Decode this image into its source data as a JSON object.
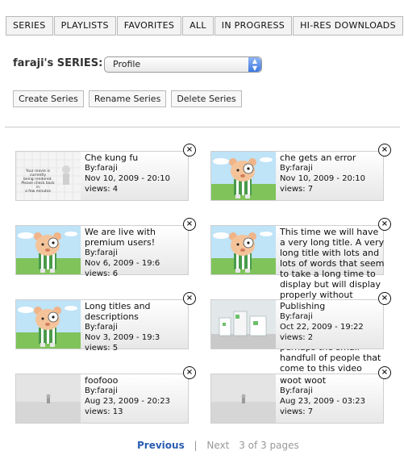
{
  "tabs": [
    "SERIES",
    "PLAYLISTS",
    "FAVORITES",
    "ALL",
    "IN PROGRESS",
    "HI-RES DOWNLOADS"
  ],
  "header": {
    "title": "faraji's SERIES:",
    "select_value": "Profile"
  },
  "buttons": {
    "create": "Create Series",
    "rename": "Rename Series",
    "delete": "Delete Series"
  },
  "cards": [
    {
      "title": "Che kung fu",
      "by": "By:faraji",
      "date": "Nov 10, 2009 - 20:10",
      "views": "views: 4",
      "thumb": "rendering",
      "thumb_lines": [
        "Your movie is currently",
        "being rendered.",
        "Please check back in",
        "a few minutes"
      ]
    },
    {
      "title": "che gets an error",
      "by": "By:faraji",
      "date": "Nov 10, 2009 - 20:10",
      "views": "views: 7",
      "thumb": "bear"
    },
    {
      "title": "We are live with premium users!",
      "by": "By:faraji",
      "date": "Nov 6, 2009 - 19:6",
      "views": "views: 6",
      "thumb": "bear"
    },
    {
      "title": "This time we will have a very long title. A very long title with lots and lots of words that seem to take a long time to display but will display properly without truncation and without generating errors or overflowing into other areas myself and perhaps the small handfull of people that come to this video expecting to be",
      "by": "By:faraji",
      "date": "Oct 22, 2009 - 19:22",
      "views": "views: 2",
      "thumb": "bear"
    },
    {
      "title": "Long titles and descriptions",
      "by": "By:faraji",
      "date": "Nov 3, 2009 - 19:3",
      "views": "views: 5",
      "thumb": "bear"
    },
    {
      "title": "Publishing",
      "by": "By:faraji",
      "date": "Oct 22, 2009 - 19:22",
      "views": "views: 2",
      "thumb": "city"
    },
    {
      "title": "foofooo",
      "by": "By:faraji",
      "date": "Aug 23, 2009 - 20:23",
      "views": "views: 13",
      "thumb": "empty"
    },
    {
      "title": "woot woot",
      "by": "By:faraji",
      "date": "Aug 23, 2009 - 03:23",
      "views": "views: 7",
      "thumb": "empty"
    }
  ],
  "pager": {
    "prev": "Previous",
    "sep": "|",
    "next": "Next",
    "pages": "3 of 3 pages"
  },
  "close_glyph": "×",
  "colors": {
    "link": "#2a5db0",
    "select_arrow": "#3e79e2"
  }
}
